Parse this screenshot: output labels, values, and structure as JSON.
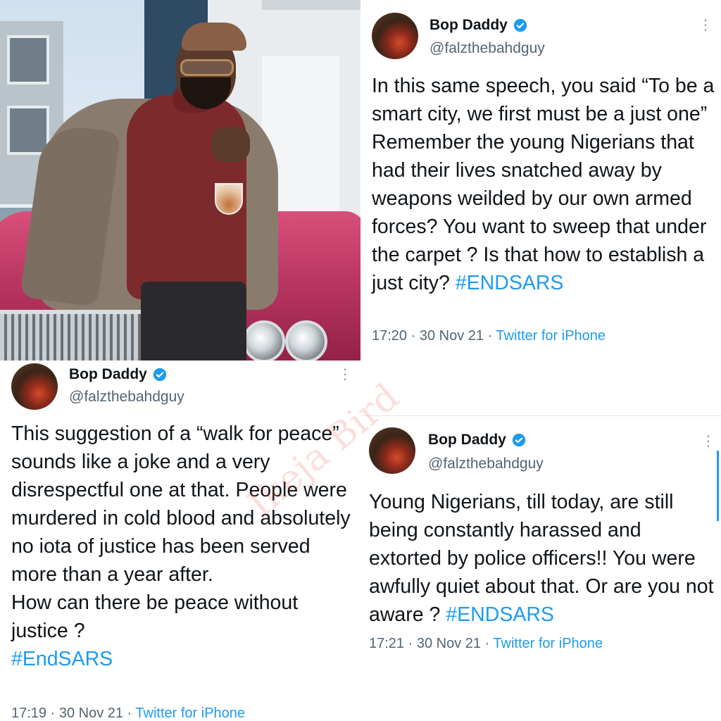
{
  "watermark": "Ikeja Bird",
  "tweets": [
    {
      "name": "Bop Daddy",
      "handle": "@falzthebahdguy",
      "text": "In this same speech, you said “To be a smart city, we first must be a just one”\nRemember the young Nigerians that had their lives snatched away by weapons weilded by our own armed forces? You want to sweep that under the carpet ? Is that how to establish a just city? ",
      "hashtag": "#ENDSARS",
      "time": "17:20 · 30 Nov 21 · ",
      "source": "Twitter for iPhone"
    },
    {
      "name": "Bop Daddy",
      "handle": "@falzthebahdguy",
      "text": "This suggestion of a “walk for peace” sounds like a joke and a very disrespectful one at that. People were murdered in cold blood and absolutely no iota of justice has been served more than a year after.\nHow can there be peace without justice ?\n",
      "hashtag": "#EndSARS",
      "time": "17:19 · 30 Nov 21 · ",
      "source": "Twitter for iPhone"
    },
    {
      "name": "Bop Daddy",
      "handle": "@falzthebahdguy",
      "text": "Young Nigerians, till today, are still being constantly harassed and extorted by police officers!! You were awfully quiet about that. Or are you not aware ? ",
      "hashtag": "#ENDSARS",
      "time": "17:21 · 30 Nov 21 · ",
      "source": "Twitter for iPhone"
    }
  ],
  "colors": {
    "link": "#1d9bf0",
    "verified": "#1d9bf0",
    "text": "#0f1419",
    "muted": "#536471"
  },
  "icons": [
    "verified-badge-icon",
    "more-options-icon"
  ]
}
